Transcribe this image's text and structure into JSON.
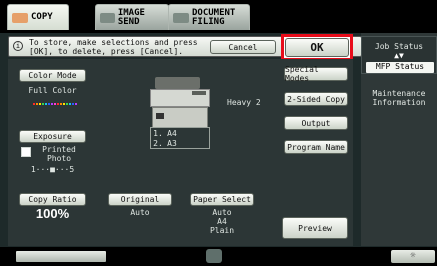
{
  "tabs": [
    {
      "label": "COPY",
      "icon": "copy-icon"
    },
    {
      "label": "IMAGE SEND",
      "icon": "image-send-icon"
    },
    {
      "label_line1": "DOCUMENT",
      "label_line2": "FILING",
      "icon": "document-filing-icon"
    }
  ],
  "message": {
    "icon": "info-icon",
    "text": "To store, make selections and press\n[OK], to delete, press [Cancel]."
  },
  "actions": {
    "cancel_label": "Cancel",
    "ok_label": "OK"
  },
  "color_mode": {
    "label": "Color Mode",
    "value": "Full Color",
    "dot_colors": [
      "#ff2a2a",
      "#ff8a00",
      "#ffe600",
      "#39d84a",
      "#19c6e8",
      "#2b5cff",
      "#b43cff",
      "#ff3ad0",
      "#ff2a2a",
      "#ff8a00",
      "#ffe600",
      "#39d84a",
      "#19c6e8",
      "#2b5cff",
      "#b43cff"
    ]
  },
  "machine": {
    "heavy_label": "Heavy 2",
    "tray1": "A4",
    "tray2": "A3",
    "tray1_num": "1.",
    "tray2_num": "2."
  },
  "exposure": {
    "label": "Exposure",
    "line1": "Printed",
    "line2": "Photo",
    "scale": "1···■···5",
    "icon": "exposure-icon"
  },
  "right_buttons": [
    "Special Modes",
    "2-Sided Copy",
    "Output",
    "Program Name"
  ],
  "copy_ratio": {
    "label": "Copy Ratio",
    "value": "100%"
  },
  "original": {
    "label": "Original",
    "value": "Auto"
  },
  "paper_select": {
    "label": "Paper Select",
    "line1": "Auto",
    "line2": "A4",
    "line3": "Plain"
  },
  "preview_label": "Preview",
  "job_status": {
    "label": "Job Status",
    "status": "MFP Status",
    "arrows": "▲▼"
  },
  "maintenance": {
    "line1": "Maintenance",
    "line2": "Information"
  },
  "bottom": {
    "center_icon": "home-icon",
    "right_icon": "brightness-icon",
    "right_glyph": "☼"
  },
  "colors": {
    "ok_highlight": "#e80c1a"
  }
}
